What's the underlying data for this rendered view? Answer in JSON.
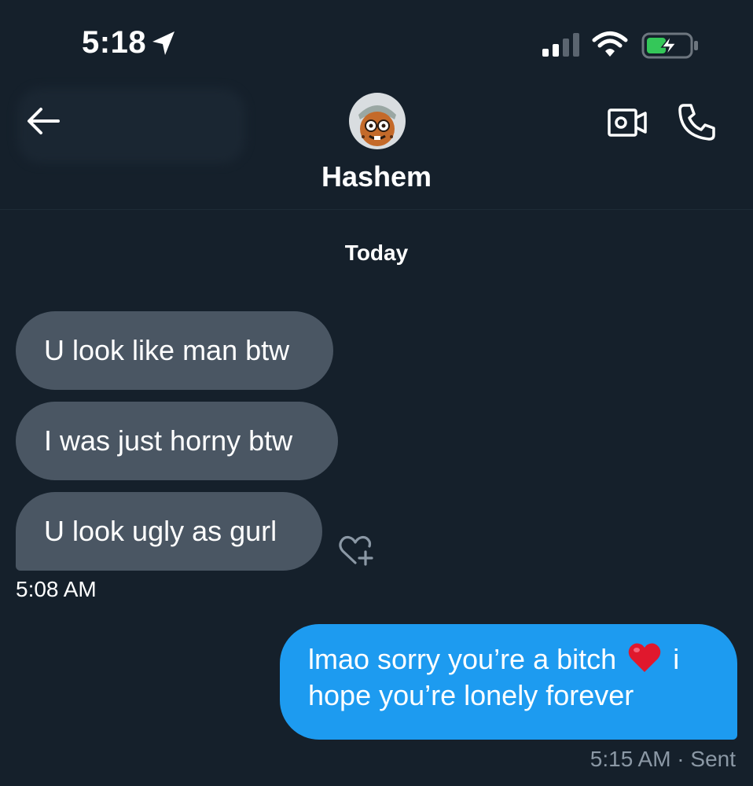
{
  "status_bar": {
    "time": "5:18",
    "icons": [
      "location-arrow-icon",
      "cellular-signal-icon",
      "wifi-icon",
      "battery-charging-icon"
    ]
  },
  "header": {
    "contact_name": "Hashem",
    "back_icon": "arrow-left-icon",
    "video_icon": "video-camera-icon",
    "call_icon": "phone-icon"
  },
  "day_separator": "Today",
  "messages": [
    {
      "direction": "incoming",
      "text": "U look like man btw"
    },
    {
      "direction": "incoming",
      "text": "I was just horny btw"
    },
    {
      "direction": "incoming",
      "text": "U look ugly as gurl"
    },
    {
      "direction": "outgoing",
      "text_before_emoji": "lmao sorry you’re a bitch",
      "emoji": "red-heart",
      "text_after_emoji": "i hope you’re lonely forever"
    }
  ],
  "incoming_timestamp": "5:08 AM",
  "outgoing_status": "5:15 AM · Sent",
  "colors": {
    "background": "#15202b",
    "incoming_bubble": "#4a5663",
    "outgoing_bubble": "#1d9bf0",
    "muted_text": "#8b98a5",
    "battery_green": "#34c759"
  }
}
